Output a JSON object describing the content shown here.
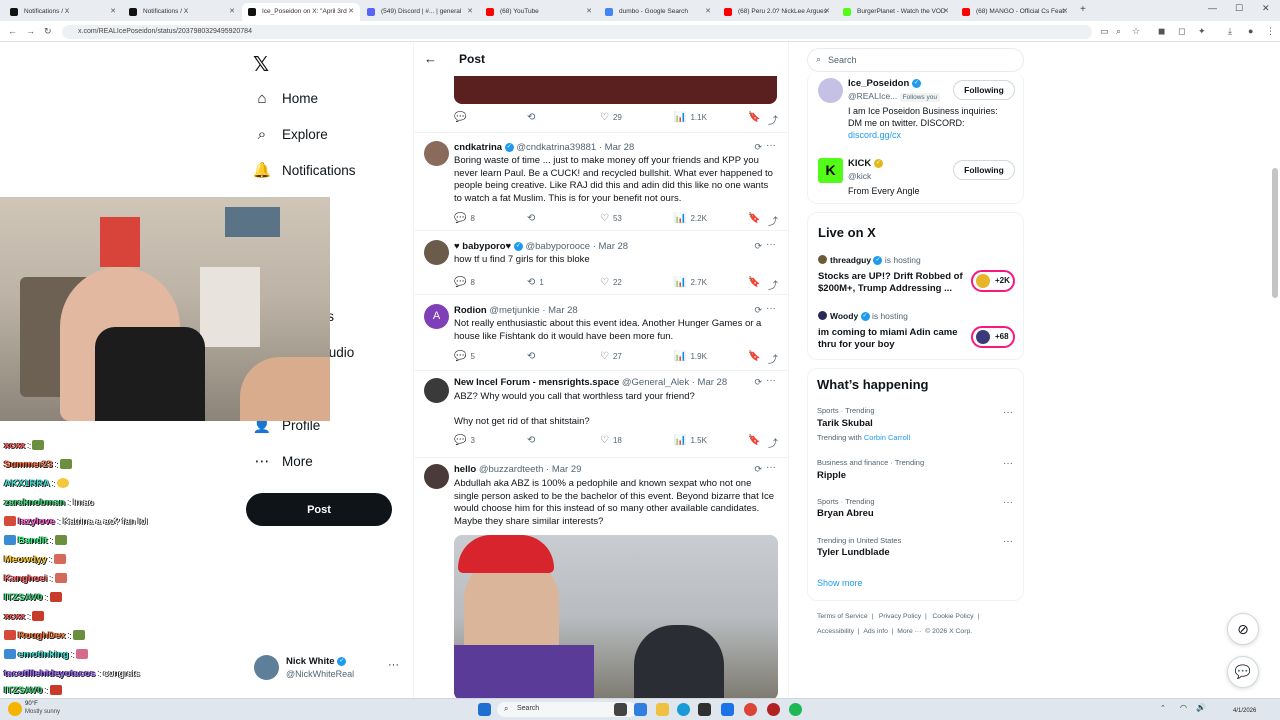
{
  "browser": {
    "tabs": [
      {
        "label": "Notifications / X",
        "color": "#111111"
      },
      {
        "label": "Notifications / X",
        "color": "#111111"
      },
      {
        "label": "Ice_Poseidon on X: \"April 3rd",
        "color": "#111111"
      },
      {
        "label": "(549) Discord | #... | general",
        "color": "#5865f2"
      },
      {
        "label": "(68) YouTube",
        "color": "#ff0000"
      },
      {
        "label": "dumbo - Google Search",
        "color": "#4285f4"
      },
      {
        "label": "(68) Peru 2.0? NickLee Argues",
        "color": "#ff0000"
      },
      {
        "label": "BurgerPlanet - Watch the VOD",
        "color": "#53fc18"
      },
      {
        "label": "(68) MANGO - Official Cs Feat.",
        "color": "#ff0000"
      }
    ],
    "url": "x.com/REALIcePoseidon/status/2037980329495920784"
  },
  "nav": {
    "items": [
      {
        "label": "Home",
        "icon": "home-icon",
        "glyph": "⌂"
      },
      {
        "label": "Explore",
        "icon": "search-icon",
        "glyph": "⌕"
      },
      {
        "label": "Notifications",
        "icon": "bell-icon",
        "glyph": "🔔"
      },
      {
        "label": "n",
        "icon": "hidden-icon",
        "glyph": ""
      },
      {
        "label": "rks",
        "icon": "hidden-icon",
        "glyph": ""
      },
      {
        "label": "Studio",
        "icon": "hidden-icon",
        "glyph": ""
      },
      {
        "label": "Profile",
        "icon": "person-icon",
        "glyph": "👤"
      },
      {
        "label": "More",
        "icon": "more-circle-icon",
        "glyph": "⋯"
      }
    ],
    "post_label": "Post",
    "account": {
      "name": "Nick White",
      "handle": "@NickWhiteReal"
    }
  },
  "chat": [
    {
      "user": "xcxx",
      "msg": ":",
      "color": "#ff5050"
    },
    {
      "user": "Summer23",
      "msg": ":",
      "color": "#ff6a3d"
    },
    {
      "user": "AKX1RRA",
      "msg": ":",
      "color": "#40e0d0"
    },
    {
      "user": "zaraknobman",
      "msg": ": lmao",
      "color": "#3dd87a"
    },
    {
      "user": "lazylove",
      "msg": ": Katrina a ao? fan lol",
      "color": "#ff5fd2"
    },
    {
      "user": "Bandit",
      "msg": ":",
      "color": "#3dff8a"
    },
    {
      "user": "Meowdyy",
      "msg": ":",
      "color": "#ffd23d"
    },
    {
      "user": "Kanghoei",
      "msg": ":",
      "color": "#ff6a6a"
    },
    {
      "user": "ITZSAV0",
      "msg": ":",
      "color": "#3dd87a"
    },
    {
      "user": "xcxx",
      "msg": ":",
      "color": "#ff5050"
    },
    {
      "user": "RoughDex",
      "msg": ":",
      "color": "#ff7a3d"
    },
    {
      "user": "emotinking",
      "msg": ":",
      "color": "#40e0d0"
    },
    {
      "user": "tacotillehideyotacos",
      "msg": ": congrats",
      "color": "#a06bff"
    },
    {
      "user": "ITZSAV0",
      "msg": ":",
      "color": "#3dd87a"
    }
  ],
  "header": {
    "title": "Post"
  },
  "top_actions": {
    "replies": "",
    "retweets": "",
    "likes": "29",
    "views": "1.1K"
  },
  "tweets": [
    {
      "name": "cndkatrina",
      "verified": true,
      "handle": "@cndkatrina39881",
      "date": "· Mar 28",
      "text": "Boring waste of time ... just to make money off your friends and KPP you never learn Paul. Be a CUCK! and recycled bullshit. What ever happened to people being creative. Like RAJ did this and adin did this like no one wants to watch a fat Muslim. This is for your benefit not ours.",
      "replies": "8",
      "retweets": "",
      "likes": "53",
      "views": "2.2K",
      "avatar": "#8a6a5a"
    },
    {
      "name": "♥ babyporo♥",
      "verified": true,
      "handle": "@babyporooce",
      "date": "· Mar 28",
      "text": "how tf u find 7 girls for this bloke",
      "replies": "8",
      "retweets": "1",
      "likes": "22",
      "views": "2.7K",
      "avatar": "#6b5b4b"
    },
    {
      "name": "Rodion",
      "verified": false,
      "handle": "@metjunkie",
      "date": "· Mar 28",
      "text": "Not really enthusiastic about this event idea. Another Hunger Games or a house like Fishtank do it would have been more fun.",
      "replies": "5",
      "retweets": "",
      "likes": "27",
      "views": "1.9K",
      "avatar": "#7e3fb8",
      "letter": "A"
    },
    {
      "name": "New Incel Forum - mensrights.space",
      "verified": false,
      "handle": "@General_Alek",
      "date": "· Mar 28",
      "text": "ABZ? Why would you call that worthless tard your friend?\n\nWhy not get rid of that shitstain?",
      "replies": "3",
      "retweets": "",
      "likes": "18",
      "views": "1.5K",
      "avatar": "#3a3a3a"
    },
    {
      "name": "hello",
      "verified": false,
      "handle": "@buzzardteeth",
      "date": "· Mar 29",
      "text": "Abdullah aka ABZ is 100% a pedophile and known sexpat who not one single person asked to be the bachelor of this event. Beyond bizarre that Ice would choose him for this instead of so many other available candidates. Maybe they share similar interests?",
      "replies": "",
      "retweets": "",
      "likes": "",
      "views": "",
      "avatar": "#4a3a3a"
    }
  ],
  "right": {
    "search_placeholder": "Search",
    "follow_cards": [
      {
        "name": "Ice_Poseidon",
        "handle": "@REALIce...",
        "follows_you": "Follows you",
        "bio": "I am Ice Poseidon Business inquiries: DM me on twitter. DISCORD:",
        "link": "discord.gg/cx",
        "button": "Following"
      },
      {
        "name": "KICK",
        "handle": "@kick",
        "bio": "From Every Angle",
        "button": "Following"
      }
    ],
    "live_title": "Live on X",
    "live": [
      {
        "host": "threadguy",
        "status": "is hosting",
        "title": "Stocks are UP!? Drift Robbed of $200M+, Trump Addressing ...",
        "count": "+2K"
      },
      {
        "host": "Woody",
        "status": "is hosting",
        "title": "im coming to miami Adin came thru for your boy",
        "count": "+68"
      }
    ],
    "happening_title": "What’s happening",
    "trends": [
      {
        "category": "Sports · Trending",
        "name": "Tarik Skubal",
        "extra_prefix": "Trending with",
        "extra_link": "Corbin Carroll"
      },
      {
        "category": "Business and finance · Trending",
        "name": "Ripple"
      },
      {
        "category": "Sports · Trending",
        "name": "Bryan Abreu"
      },
      {
        "category": "Trending in United States",
        "name": "Tyler Lundblade"
      }
    ],
    "show_more": "Show more",
    "footer": [
      "Terms of Service",
      "|",
      "Privacy Policy",
      "|",
      "Cookie Policy",
      "|",
      "Accessibility",
      "|",
      "Ads info",
      "|",
      "More ···",
      "© 2026 X Corp."
    ]
  },
  "taskbar": {
    "weather_temp": "90°F",
    "weather_text": "Mostly sunny",
    "search_label": "Search",
    "date": "4/1/2026"
  },
  "colors": {
    "accent": "#1d9bf0",
    "brand_dark": "#0f1419",
    "kick": "#53fc18"
  }
}
